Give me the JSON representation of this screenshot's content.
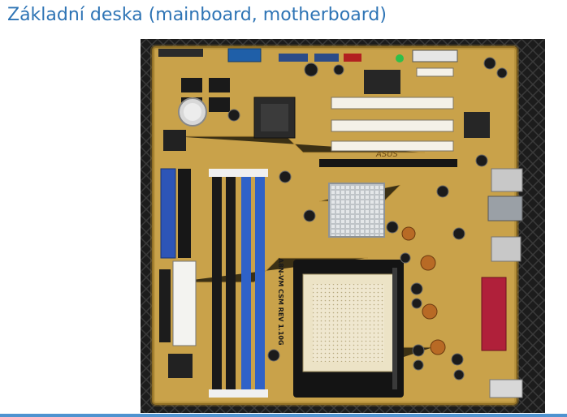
{
  "slide": {
    "title": "Základní deska (mainboard, motherboard)"
  },
  "photo": {
    "description_icon": "motherboard-photo",
    "board_label": "A8N-VM CSM REV 1.10G",
    "brand": "ASUS"
  },
  "colors": {
    "title": "#2e74b5",
    "bottom_bar": "#4f93d0",
    "pcb": "#c9a24a",
    "dimm_blue": "#2f62c8",
    "dimm_black": "#1a1a1a"
  }
}
